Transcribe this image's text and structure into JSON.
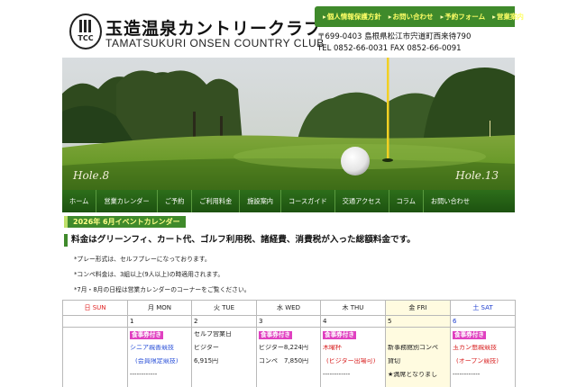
{
  "header": {
    "logo_text": "TCC",
    "title_ja": "玉造温泉カントリークラブ",
    "title_en": "TAMATSUKURI ONSEN COUNTRY CLUB",
    "address": "〒699-0403 島根県松江市宍道町西来待790",
    "phone": "TEL 0852-66-0031 FAX 0852-66-0091",
    "top_links": [
      "個人情報保護方針",
      "お問い合わせ",
      "予約フォーム",
      "営業案内"
    ]
  },
  "hero": {
    "hole_left": "Hole.8",
    "hole_right": "Hole.13"
  },
  "nav": [
    "ホーム",
    "営業カレンダー",
    "ご予約",
    "ご利用料金",
    "施設案内",
    "コースガイド",
    "交通アクセス",
    "コラム",
    "お問い合わせ"
  ],
  "content": {
    "section_title": "2026年 6月イベントカレンダー",
    "lead": "料金はグリーンフィ、カート代、ゴルフ利用税、諸経費、消費税が入った総額料金です。",
    "notes": [
      "*プレー形式は、セルフプレーになっております。",
      "*コンペ料金は、3組以上(9人以上)の時適用されます。",
      "*7月・8月の日程は営業カレンダーのコーナーをご覧ください。"
    ]
  },
  "calendar": {
    "headers": [
      "日 SUN",
      "月 MON",
      "火 TUE",
      "水 WED",
      "木 THU",
      "金 FRI",
      "土 SAT"
    ],
    "dates": [
      "",
      "1",
      "2",
      "3",
      "4",
      "5",
      "6"
    ],
    "cells": [
      {
        "lines": []
      },
      {
        "lines": [
          {
            "text": "食事券付き",
            "style": "tag"
          },
          {
            "text": "シニア親善競技",
            "style": "blue"
          },
          {
            "text": "(会員限定競技)",
            "style": "blue-c"
          },
          {
            "text": "------------",
            "style": "plain"
          }
        ]
      },
      {
        "lines": [
          {
            "text": "セルフ営業日",
            "style": "plain"
          },
          {
            "text": "ビジター",
            "style": "plain"
          },
          {
            "text": "6,915円",
            "style": "plain"
          }
        ]
      },
      {
        "lines": [
          {
            "text": "食事券付き",
            "style": "tag"
          },
          {
            "text": "ビジター8,224円",
            "style": "plain"
          },
          {
            "text": "コンペ　7,850円",
            "style": "plain"
          }
        ]
      },
      {
        "lines": [
          {
            "text": "食事券付き",
            "style": "tag"
          },
          {
            "text": "木曜杯",
            "style": "red"
          },
          {
            "text": "(ビジター出場可)",
            "style": "red-c"
          },
          {
            "text": "------------",
            "style": "plain"
          }
        ]
      },
      {
        "lines": [
          {
            "text": "",
            "style": "plain"
          },
          {
            "text": "新事務館別コンペ",
            "style": "plain"
          },
          {
            "text": "貸切",
            "style": "plain"
          },
          {
            "text": "★満席となりまし",
            "style": "plain"
          }
        ]
      },
      {
        "lines": [
          {
            "text": "食事券付き",
            "style": "tag"
          },
          {
            "text": "玉カン懇親競技",
            "style": "red"
          },
          {
            "text": "(オープン競技)",
            "style": "red-c"
          },
          {
            "text": "------------",
            "style": "plain"
          }
        ]
      }
    ]
  },
  "colors": {
    "brand_green": "#3f8a2b",
    "nav_green": "#2d6e1a",
    "link_yellow": "#ffff66",
    "tag_pink": "#e040c0",
    "sun_red": "#e02020",
    "sat_blue": "#2040d0"
  }
}
